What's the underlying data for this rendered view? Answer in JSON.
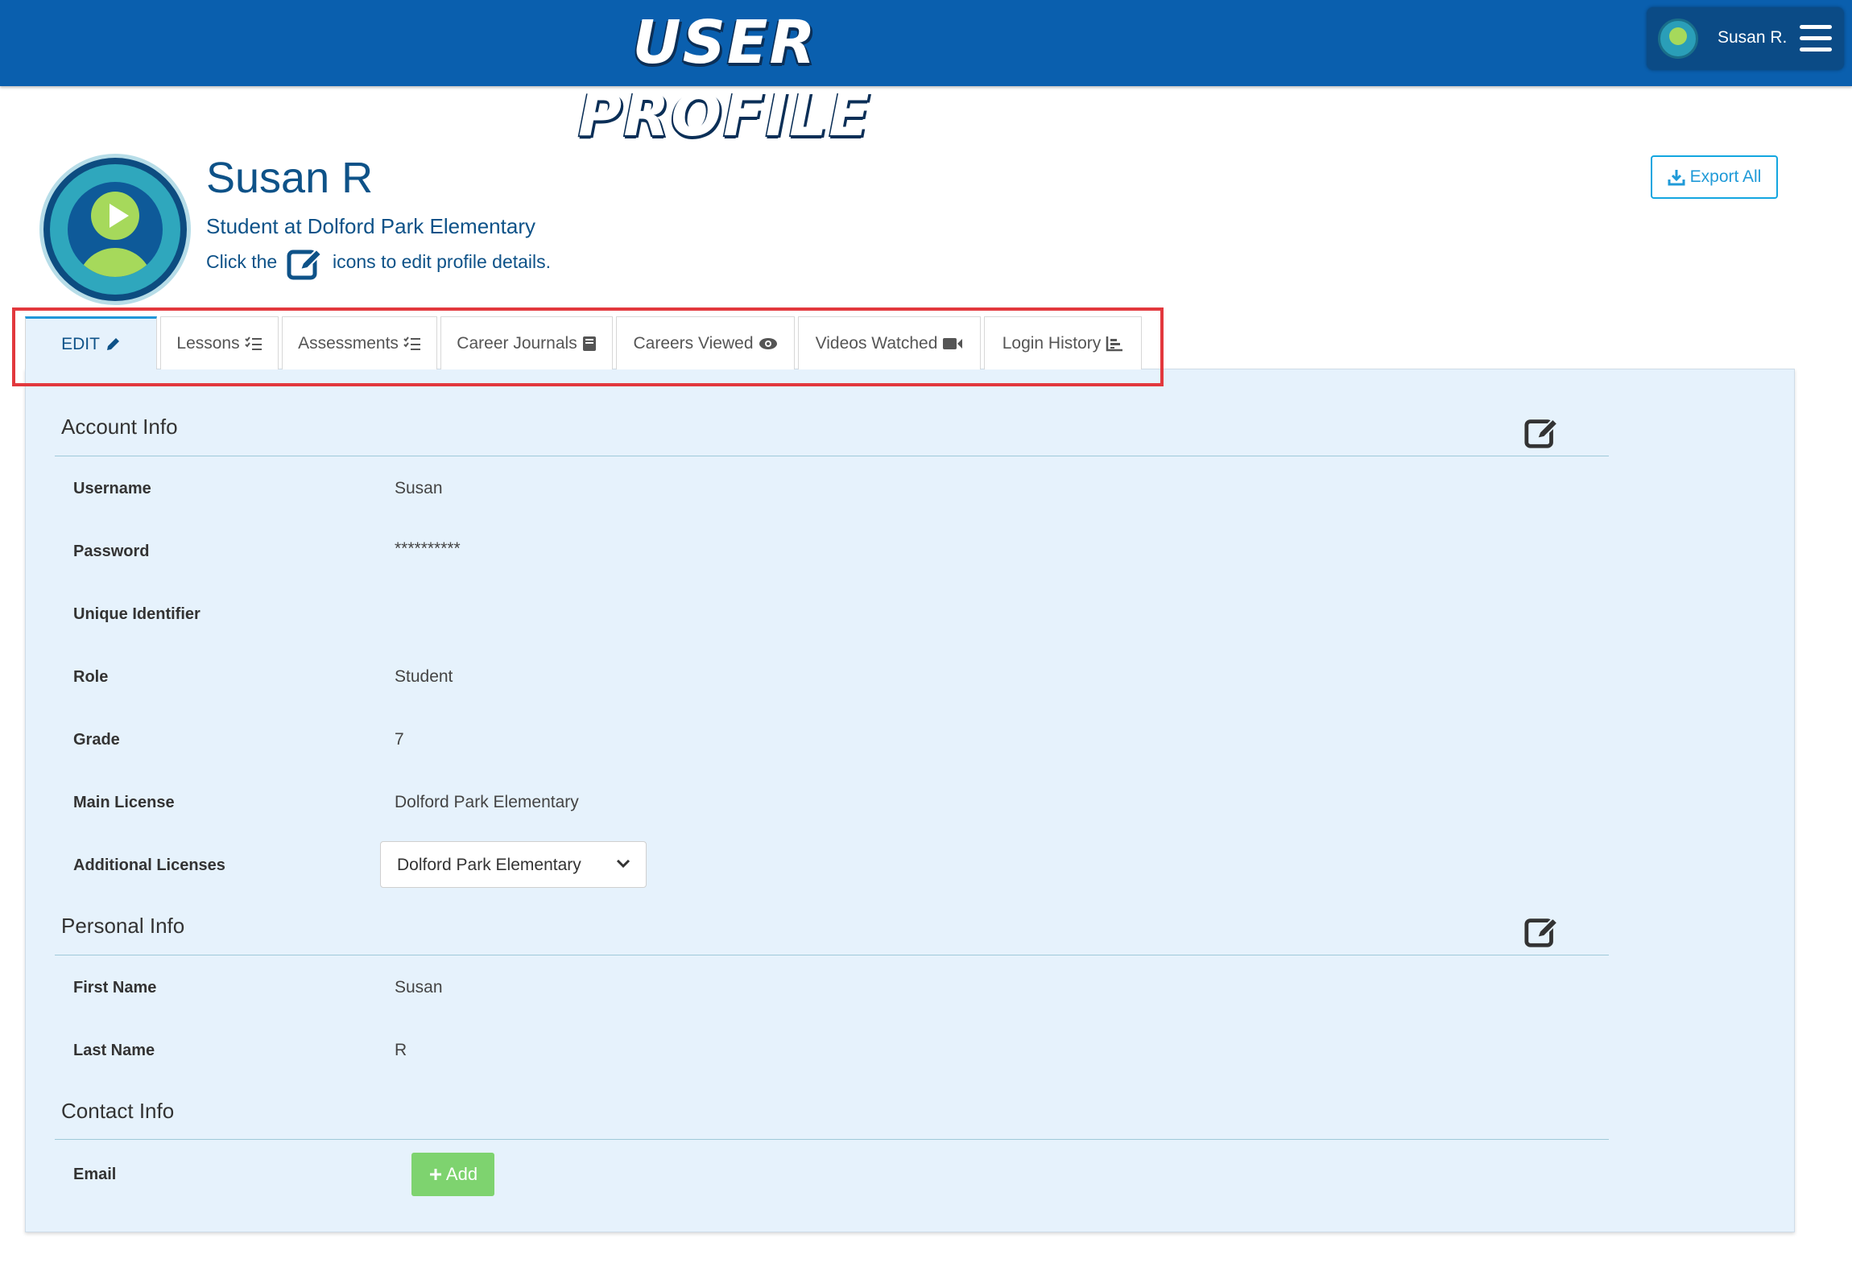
{
  "header": {
    "app_title": "USER PROFILE",
    "user_name": "Susan R.",
    "menu_icon": "hamburger-icon"
  },
  "profile": {
    "name": "Susan R",
    "subtitle": "Student at Dolford Park Elementary",
    "hint_before": "Click the",
    "hint_after": "icons to edit profile details.",
    "export_label": "Export All"
  },
  "tabs": [
    {
      "label": "EDIT",
      "icon": "pencil-icon",
      "active": true
    },
    {
      "label": "Lessons",
      "icon": "checklist-icon"
    },
    {
      "label": "Assessments",
      "icon": "checklist-icon"
    },
    {
      "label": "Career Journals",
      "icon": "book-icon"
    },
    {
      "label": "Careers Viewed",
      "icon": "eye-icon"
    },
    {
      "label": "Videos Watched",
      "icon": "video-camera-icon"
    },
    {
      "label": "Login History",
      "icon": "bar-chart-icon"
    }
  ],
  "account_info": {
    "title": "Account Info",
    "username_label": "Username",
    "username_value": "Susan",
    "password_label": "Password",
    "password_value": "**********",
    "unique_id_label": "Unique Identifier",
    "unique_id_value": "",
    "role_label": "Role",
    "role_value": "Student",
    "grade_label": "Grade",
    "grade_value": "7",
    "main_license_label": "Main License",
    "main_license_value": "Dolford Park Elementary",
    "additional_licenses_label": "Additional Licenses",
    "additional_licenses_value": "Dolford Park Elementary"
  },
  "personal_info": {
    "title": "Personal Info",
    "first_name_label": "First Name",
    "first_name_value": "Susan",
    "last_name_label": "Last Name",
    "last_name_value": "R"
  },
  "contact_info": {
    "title": "Contact Info",
    "email_label": "Email",
    "add_label": "Add"
  },
  "colors": {
    "header_bg": "#0a5fae",
    "panel_bg": "#e6f2fc",
    "accent_text": "#0e5288",
    "highlight_border": "#e2383d",
    "add_button": "#7ed36f"
  }
}
